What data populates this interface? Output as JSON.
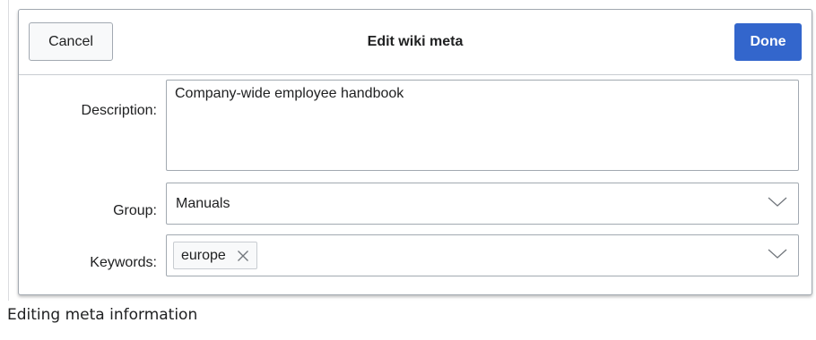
{
  "dialog": {
    "title": "Edit wiki meta",
    "cancel_label": "Cancel",
    "done_label": "Done",
    "accent_color": "#3366cc"
  },
  "fields": {
    "description": {
      "label": "Description:",
      "value": "Company-wide employee handbook"
    },
    "group": {
      "label": "Group:",
      "selected": "Manuals",
      "icon": "chevron-down-icon"
    },
    "keywords": {
      "label": "Keywords:",
      "tags": [
        "europe"
      ],
      "tag_remove_icon": "close-icon",
      "icon": "chevron-down-icon"
    }
  },
  "caption": "Editing meta information"
}
